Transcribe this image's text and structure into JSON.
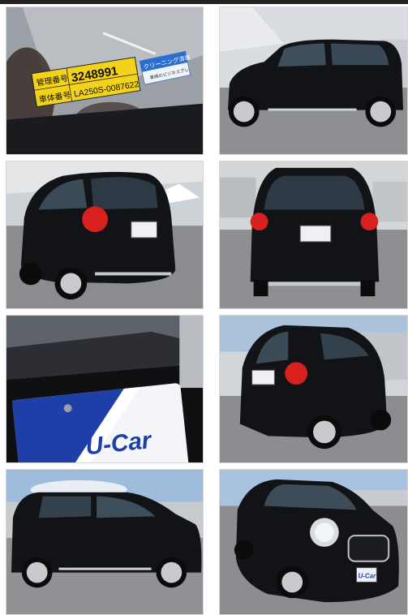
{
  "sticker": {
    "row1_label": "管理番号",
    "row1_value": "3248991",
    "row2_label": "車体番号",
    "row2_value": "LA250S-0087622"
  },
  "cleaning_tag": {
    "line1": "クリーニング済車",
    "line2": "車検のビジネスプレ"
  },
  "plate": {
    "text": "U-Car"
  },
  "colors": {
    "car_body": "#121316",
    "tail_light": "#d8201e",
    "sticker_yellow": "#f3d21a",
    "plate_blue": "#1f3fa8",
    "sky": "#bcd3ea"
  }
}
